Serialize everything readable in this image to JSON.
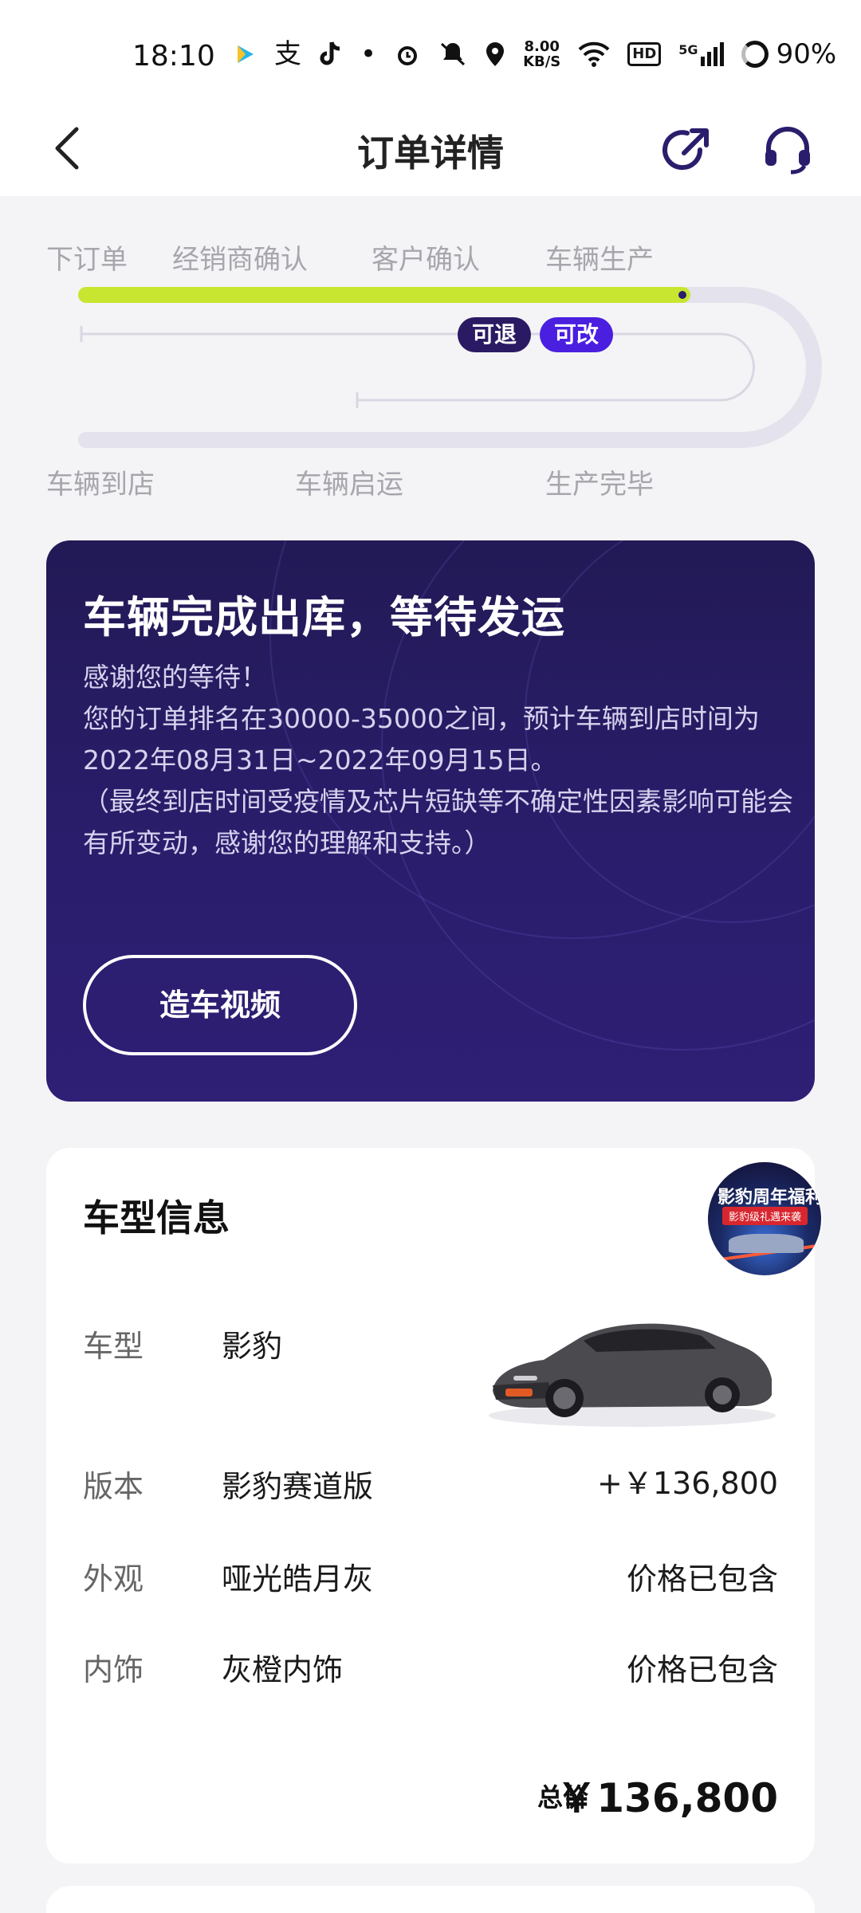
{
  "status_bar": {
    "time": "18:10",
    "icons": [
      "video-app-icon",
      "alipay-icon",
      "tiktok-icon",
      "dot-icon",
      "alarm-icon",
      "mute-icon",
      "location-icon",
      "wifi-icon",
      "hd-icon",
      "signal-5g-icon",
      "battery-icon"
    ],
    "speed_value": "8.00",
    "speed_unit": "KB/S",
    "hd": "HD",
    "network": "5G",
    "battery": "90%"
  },
  "nav": {
    "title": "订单详情",
    "back_icon": "back-arrow-icon",
    "share_icon": "share-icon",
    "service_icon": "customer-service-icon"
  },
  "progress": {
    "top_stages": [
      "下订单",
      "经销商确认",
      "客户确认",
      "车辆生产"
    ],
    "bottom_stages": [
      "车辆到店",
      "车辆启运",
      "生产完毕"
    ],
    "badges": {
      "refund": "可退",
      "modify": "可改"
    },
    "accent_color": "#c8e630",
    "track_color": "#e4e2ec"
  },
  "status_card": {
    "title": "车辆完成出库，等待发运",
    "lines": [
      "感谢您的等待！",
      "您的订单排名在30000-35000之间，预计车辆到店时间为2022年08月31日~2022年09月15日。",
      "（最终到店时间受疫情及芯片短缺等不确定性因素影响可能会有所变动，感谢您的理解和支持。）"
    ],
    "video_button": "造车视频",
    "bg_color": "#2a1d6c"
  },
  "car_info": {
    "title": "车型信息",
    "promo": {
      "title": "影豹周年福利",
      "subtitle": "影豹级礼遇来袭"
    },
    "rows": [
      {
        "label": "车型",
        "value": "影豹",
        "price": ""
      },
      {
        "label": "版本",
        "value": "影豹赛道版",
        "price": "+￥136,800"
      },
      {
        "label": "外观",
        "value": "哑光皓月灰",
        "price": "价格已包含"
      },
      {
        "label": "内饰",
        "value": "灰橙内饰",
        "price": "价格已包含"
      }
    ],
    "total_label": "总价",
    "total_value": "￥136,800"
  }
}
